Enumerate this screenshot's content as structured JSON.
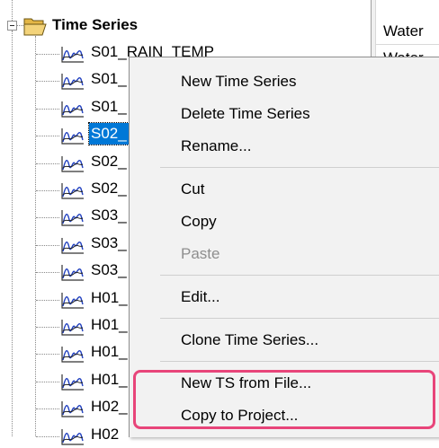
{
  "tree": {
    "root_label": "Time Series",
    "items": [
      {
        "label": "S01_RAIN_TEMP",
        "selected": false
      },
      {
        "label": "S01_",
        "selected": false
      },
      {
        "label": "S01_",
        "selected": false
      },
      {
        "label": "S02_",
        "selected": true
      },
      {
        "label": "S02_",
        "selected": false
      },
      {
        "label": "S02_",
        "selected": false
      },
      {
        "label": "S03_",
        "selected": false
      },
      {
        "label": "S03_",
        "selected": false
      },
      {
        "label": "S03_",
        "selected": false
      },
      {
        "label": "H01_",
        "selected": false
      },
      {
        "label": "H01_",
        "selected": false
      },
      {
        "label": "H01_",
        "selected": false
      },
      {
        "label": "H01_",
        "selected": false
      },
      {
        "label": "H02_",
        "selected": false
      },
      {
        "label": "H02",
        "selected": false
      }
    ]
  },
  "right_panel": {
    "cells": [
      "Water",
      "Water"
    ]
  },
  "context_menu": {
    "items": [
      {
        "label": "New Time Series",
        "enabled": true
      },
      {
        "label": "Delete Time Series",
        "enabled": true
      },
      {
        "label": "Rename...",
        "enabled": true
      },
      {
        "label": "Cut",
        "enabled": true
      },
      {
        "label": "Copy",
        "enabled": true
      },
      {
        "label": "Paste",
        "enabled": false
      },
      {
        "label": "Edit...",
        "enabled": true
      },
      {
        "label": "Clone Time Series...",
        "enabled": true
      },
      {
        "label": "New TS from File...",
        "enabled": true
      },
      {
        "label": "Copy to Project...",
        "enabled": true
      }
    ]
  },
  "colors": {
    "selection": "#0078d7",
    "highlight_border": "#e8457a",
    "menu_background": "#f2f2f2",
    "disabled_text": "#8e8e8e"
  }
}
